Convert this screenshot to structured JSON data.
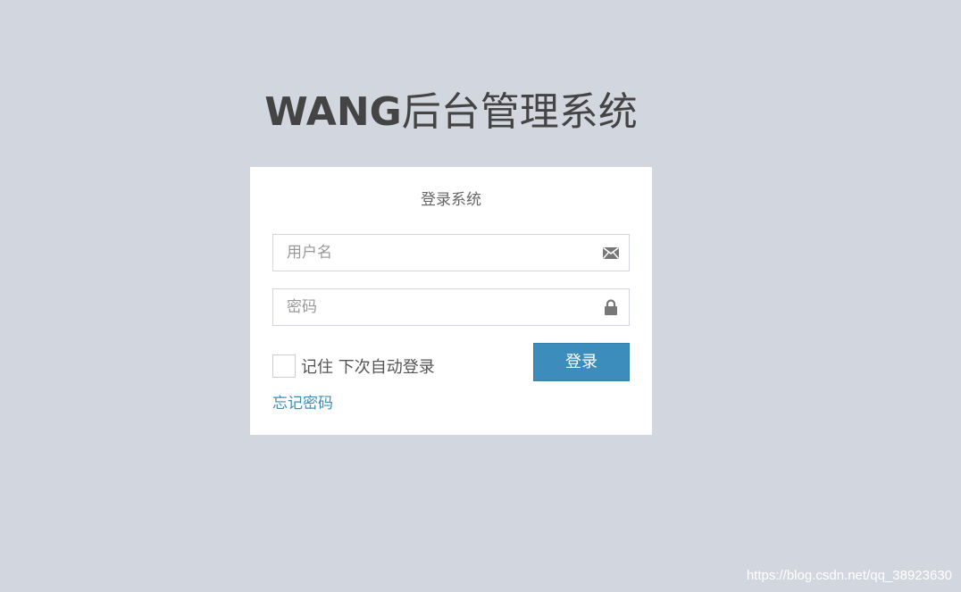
{
  "logo": {
    "brand": "WANG",
    "rest": "后台管理系统"
  },
  "login_box": {
    "title": "登录系统",
    "username_placeholder": "用户名",
    "username_icon": "envelope-icon",
    "password_placeholder": "密码",
    "password_icon": "lock-icon",
    "remember_label": "记住 下次自动登录",
    "remember_checked": false,
    "submit_label": "登录",
    "forgot_label": "忘记密码"
  },
  "watermark": "https://blog.csdn.net/qq_38923630",
  "colors": {
    "page_background": "#d2d6de",
    "box_background": "#ffffff",
    "primary": "#3c8dbc",
    "text": "#444444",
    "icon": "#777777"
  }
}
